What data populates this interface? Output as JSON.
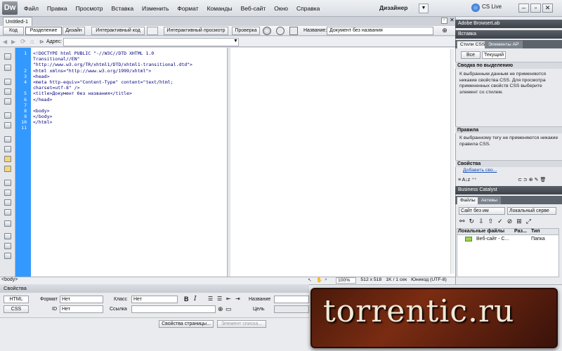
{
  "app": {
    "logo": "Dw",
    "workspace": "Дизайнер",
    "cs_live": "CS Live"
  },
  "menu": [
    "Файл",
    "Правка",
    "Просмотр",
    "Вставка",
    "Изменить",
    "Формат",
    "Команды",
    "Веб-сайт",
    "Окно",
    "Справка"
  ],
  "document_tab": "Untitled-1",
  "toolbar": {
    "code": "Код",
    "split": "Разделение",
    "design": "Дизайн",
    "live_code": "Интерактивный код",
    "live_view": "Интерактивный просмотр",
    "inspect": "Проверка",
    "title_label": "Название:",
    "title_value": "Документ без названия"
  },
  "address": {
    "label": "Адрес:",
    "value": ""
  },
  "code": {
    "line_numbers": [
      "1",
      "",
      "",
      "2",
      "3",
      "4",
      "",
      "5",
      "6",
      "7",
      "8",
      "9",
      "10",
      "11"
    ],
    "lines": [
      "<!DOCTYPE html PUBLIC \"-//W3C//DTD XHTML 1.0",
      "Transitional//EN\"",
      "\"http://www.w3.org/TR/xhtml1/DTD/xhtml1-transitional.dtd\">",
      "<html xmlns=\"http://www.w3.org/1999/xhtml\">",
      "<head>",
      "<meta http-equiv=\"Content-Type\" content=\"text/html;",
      "charset=utf-8\" />",
      "<title>Документ без названия</title>",
      "</head>",
      "",
      "<body>",
      "</body>",
      "</html>",
      ""
    ]
  },
  "status": {
    "tag": "<body>",
    "zoom": "100%",
    "size": "512 x 518",
    "download": "1K / 1 сек",
    "encoding": "Юникод (UTF-8)"
  },
  "properties": {
    "title": "Свойства",
    "html": "HTML",
    "css": "CSS",
    "format_label": "Формат",
    "format_value": "Нет",
    "id_label": "ID",
    "id_value": "Нет",
    "class_label": "Класс",
    "class_value": "Нет",
    "link_label": "Ссылка",
    "name_label": "Название",
    "target_label": "Цель",
    "page_props": "Свойства страницы...",
    "list_item": "Элемент списка..."
  },
  "right_panel": {
    "browserlab": "Adobe BrowserLab",
    "insert": "Вставка",
    "css_tab": "Стили CSS",
    "ap_tab": "Элементы AP",
    "all": "Все",
    "current": "Текущий",
    "summary_title": "Сводка по выделению",
    "summary_text": "К выбранным данным не применяются никакие свойства CSS.  Для просмотра примененных свойств CSS выберите элемент со стилем.",
    "rules_title": "Правила",
    "rules_text": "К выбранному тегу не применяются никакие правила CSS.",
    "props_title": "Свойства",
    "add_prop": "Добавить сво...",
    "catalyst": "Business Catalyst",
    "files_tab": "Файлы",
    "assets_tab": "Активы",
    "site_select": "Сайт без им",
    "view_select": "Локальный серве",
    "col_local": "Локальные файлы",
    "col_size": "Раз...",
    "col_type": "Тип",
    "row_name": "Веб-сайт - С...",
    "row_type": "Папка"
  },
  "watermark": "torrentic.ru"
}
